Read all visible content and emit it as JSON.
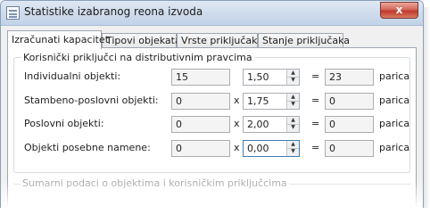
{
  "window": {
    "title": "Statistike izabranog reona izvoda",
    "close_glyph": "x"
  },
  "tabs": [
    {
      "label": "Izračunati kapacitet",
      "active": true
    },
    {
      "label": "Tipovi objekata",
      "active": false
    },
    {
      "label": "Vrste priključaka",
      "active": false
    },
    {
      "label": "Stanje priključaka",
      "active": false
    }
  ],
  "group_main": {
    "title": "Korisnički priključci na distributivnim pravcima",
    "rows": [
      {
        "label": "Individualni objekti:",
        "count": "15",
        "multiply": "x",
        "factor": "1,50",
        "equals": "=",
        "result": "23",
        "unit": "parica"
      },
      {
        "label": "Stambeno-poslovni objekti:",
        "count": "0",
        "multiply": "x",
        "factor": "1,75",
        "equals": "=",
        "result": "0",
        "unit": "parica"
      },
      {
        "label": "Poslovni objekti:",
        "count": "0",
        "multiply": "x",
        "factor": "2,00",
        "equals": "=",
        "result": "0",
        "unit": "parica"
      },
      {
        "label": "Objekti posebne namene:",
        "count": "0",
        "multiply": "x",
        "factor": "0,00",
        "equals": "=",
        "result": "0",
        "unit": "parica"
      }
    ]
  },
  "group_summary": {
    "title": "Sumarni podaci o objektima i korisničkim priključcima"
  },
  "icons": {
    "spin_up": "▲",
    "spin_down": "▼"
  }
}
